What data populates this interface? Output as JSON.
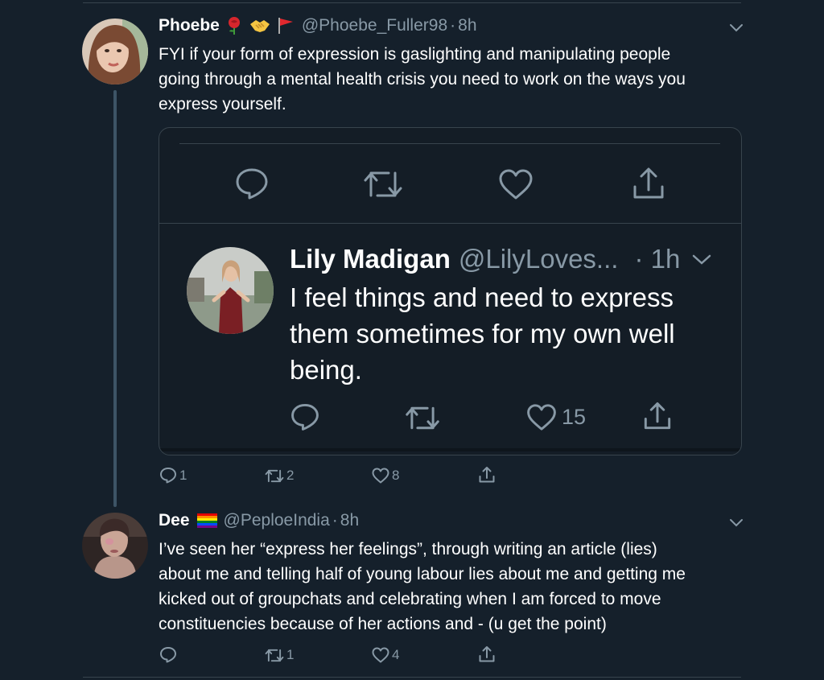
{
  "tweet1": {
    "name": "Phoebe",
    "emojis": [
      "rose-emoji",
      "handshake-emoji",
      "red-flag-emoji"
    ],
    "handle": "@Phoebe_Fuller98",
    "separator": "·",
    "time": "8h",
    "text_lines": [
      "FYI if your form of expression is gaslighting and manipulating people",
      "going through a mental health crisis you need to work on the ways you",
      "express yourself."
    ],
    "actions": {
      "replies": "1",
      "retweets": "2",
      "likes": "8"
    },
    "embedded": {
      "name": "Lily Madigan",
      "handle": "@LilyLoves...",
      "time": "· 1h",
      "text_lines": [
        "I feel things and need to express",
        "them sometimes for my own well",
        "being."
      ],
      "likes": "15"
    }
  },
  "tweet2": {
    "name": "Dee",
    "emojis": [
      "rainbow-flag-emoji"
    ],
    "handle": "@PeploeIndia",
    "separator": "·",
    "time": "8h",
    "text_lines": [
      "I’ve seen her “express her feelings”, through writing an article (lies)",
      "about me and telling half of young labour lies about me and getting me",
      "kicked out of groupchats and celebrating when I am forced to move",
      "constituencies because of her actions and - (u get the point)"
    ],
    "actions": {
      "replies": "",
      "retweets": "1",
      "likes": "4"
    }
  },
  "colors": {
    "background": "#15202b",
    "secondary_text": "#8899a6",
    "divider": "#38444d",
    "thread_line": "#3d5466"
  }
}
